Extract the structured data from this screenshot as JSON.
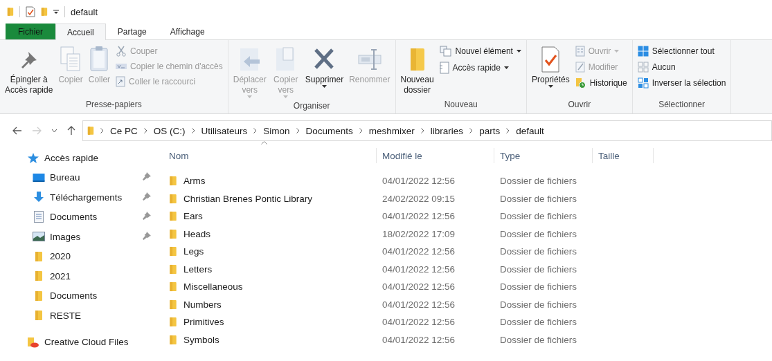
{
  "title_bar": {
    "title": "default"
  },
  "tabs": [
    {
      "label": "Fichier",
      "kind": "file",
      "selected": false
    },
    {
      "label": "Accueil",
      "kind": "tab",
      "selected": true
    },
    {
      "label": "Partage",
      "kind": "tab",
      "selected": false
    },
    {
      "label": "Affichage",
      "kind": "tab",
      "selected": false
    }
  ],
  "ribbon": {
    "groups": [
      {
        "label": "Presse-papiers",
        "items": [
          {
            "label": "Épingler à\nAccès rapide",
            "kind": "large",
            "disabled": false,
            "dropdown": false
          },
          {
            "label": "Copier",
            "kind": "large",
            "disabled": true,
            "dropdown": false
          },
          {
            "label": "Coller",
            "kind": "large",
            "disabled": true,
            "dropdown": false
          },
          {
            "label": "Couper",
            "kind": "small",
            "disabled": true,
            "dropdown": false
          },
          {
            "label": "Copier le chemin d'accès",
            "kind": "small",
            "disabled": true,
            "dropdown": false
          },
          {
            "label": "Coller le raccourci",
            "kind": "small",
            "disabled": true,
            "dropdown": false
          }
        ]
      },
      {
        "label": "Organiser",
        "items": [
          {
            "label": "Déplacer\nvers",
            "kind": "large",
            "disabled": true,
            "dropdown": true
          },
          {
            "label": "Copier\nvers",
            "kind": "large",
            "disabled": true,
            "dropdown": true
          },
          {
            "label": "Supprimer",
            "kind": "large",
            "disabled": false,
            "dropdown": true
          },
          {
            "label": "Renommer",
            "kind": "large",
            "disabled": true,
            "dropdown": false
          }
        ]
      },
      {
        "label": "Nouveau",
        "items": [
          {
            "label": "Nouveau\ndossier",
            "kind": "large",
            "disabled": false,
            "dropdown": false
          },
          {
            "label": "Nouvel élément",
            "kind": "small",
            "disabled": false,
            "dropdown": true
          },
          {
            "label": "Accès rapide",
            "kind": "small",
            "disabled": false,
            "dropdown": true
          }
        ]
      },
      {
        "label": "Ouvrir",
        "items": [
          {
            "label": "Propriétés",
            "kind": "large",
            "disabled": false,
            "dropdown": true
          },
          {
            "label": "Ouvrir",
            "kind": "small",
            "disabled": true,
            "dropdown": true
          },
          {
            "label": "Modifier",
            "kind": "small",
            "disabled": true,
            "dropdown": false
          },
          {
            "label": "Historique",
            "kind": "small",
            "disabled": false,
            "dropdown": false
          }
        ]
      },
      {
        "label": "Sélectionner",
        "items": [
          {
            "label": "Sélectionner tout",
            "kind": "small",
            "disabled": false,
            "dropdown": false
          },
          {
            "label": "Aucun",
            "kind": "small",
            "disabled": false,
            "dropdown": false
          },
          {
            "label": "Inverser la sélection",
            "kind": "small",
            "disabled": false,
            "dropdown": false
          }
        ]
      }
    ]
  },
  "navigation": {
    "back_disabled": false,
    "forward_disabled": true
  },
  "address_bar": {
    "path": [
      "Ce PC",
      "OS (C:)",
      "Utilisateurs",
      "Simon",
      "Documents",
      "meshmixer",
      "libraries",
      "parts",
      "default"
    ]
  },
  "sidebar": {
    "items": [
      {
        "label": "Accès rapide",
        "kind": "quick-access",
        "children": [
          {
            "label": "Bureau",
            "kind": "desktop",
            "pinned": true
          },
          {
            "label": "Téléchargements",
            "kind": "downloads",
            "pinned": true
          },
          {
            "label": "Documents",
            "kind": "documents",
            "pinned": true
          },
          {
            "label": "Images",
            "kind": "images",
            "pinned": true
          },
          {
            "label": "2020",
            "kind": "folder",
            "pinned": false
          },
          {
            "label": "2021",
            "kind": "folder",
            "pinned": false
          },
          {
            "label": "Documents",
            "kind": "folder",
            "pinned": false
          },
          {
            "label": "RESTE",
            "kind": "folder",
            "pinned": false
          }
        ]
      },
      {
        "label": "Creative Cloud Files",
        "kind": "cloud"
      }
    ]
  },
  "file_list": {
    "columns": [
      "Nom",
      "Modifié le",
      "Type",
      "Taille"
    ],
    "rows": [
      {
        "name": "Arms",
        "modified": "04/01/2022 12:56",
        "type": "Dossier de fichiers"
      },
      {
        "name": "Christian Brenes Pontic Library",
        "modified": "24/02/2022 09:15",
        "type": "Dossier de fichiers"
      },
      {
        "name": "Ears",
        "modified": "04/01/2022 12:56",
        "type": "Dossier de fichiers"
      },
      {
        "name": "Heads",
        "modified": "18/02/2022 17:09",
        "type": "Dossier de fichiers"
      },
      {
        "name": "Legs",
        "modified": "04/01/2022 12:56",
        "type": "Dossier de fichiers"
      },
      {
        "name": "Letters",
        "modified": "04/01/2022 12:56",
        "type": "Dossier de fichiers"
      },
      {
        "name": "Miscellaneous",
        "modified": "04/01/2022 12:56",
        "type": "Dossier de fichiers"
      },
      {
        "name": "Numbers",
        "modified": "04/01/2022 12:56",
        "type": "Dossier de fichiers"
      },
      {
        "name": "Primitives",
        "modified": "04/01/2022 12:56",
        "type": "Dossier de fichiers"
      },
      {
        "name": "Symbols",
        "modified": "04/01/2022 12:56",
        "type": "Dossier de fichiers"
      }
    ]
  }
}
